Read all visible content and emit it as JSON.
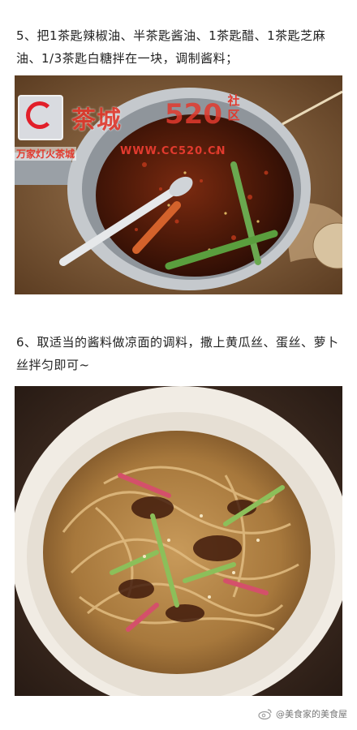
{
  "steps": [
    {
      "text": "5、把1茶匙辣椒油、半茶匙酱油、1茶匙醋、1茶匙芝麻油、1/3茶匙白糖拌在一块，调制酱料；"
    },
    {
      "text": "6、取适当的酱料做凉面的调料，撒上黄瓜丝、蛋丝、萝卜丝拌匀即可~"
    }
  ],
  "watermark": {
    "site_name": "茶城",
    "site_number": "520",
    "site_suffix": "社区",
    "slogan": "万家灯火茶城",
    "url": "WWW.CC520.CN"
  },
  "footer": {
    "icon": "weibo-icon",
    "handle": "@美食家的美食屋"
  },
  "colors": {
    "watermark_red": "#e23a2e",
    "background": "#ffffff"
  }
}
